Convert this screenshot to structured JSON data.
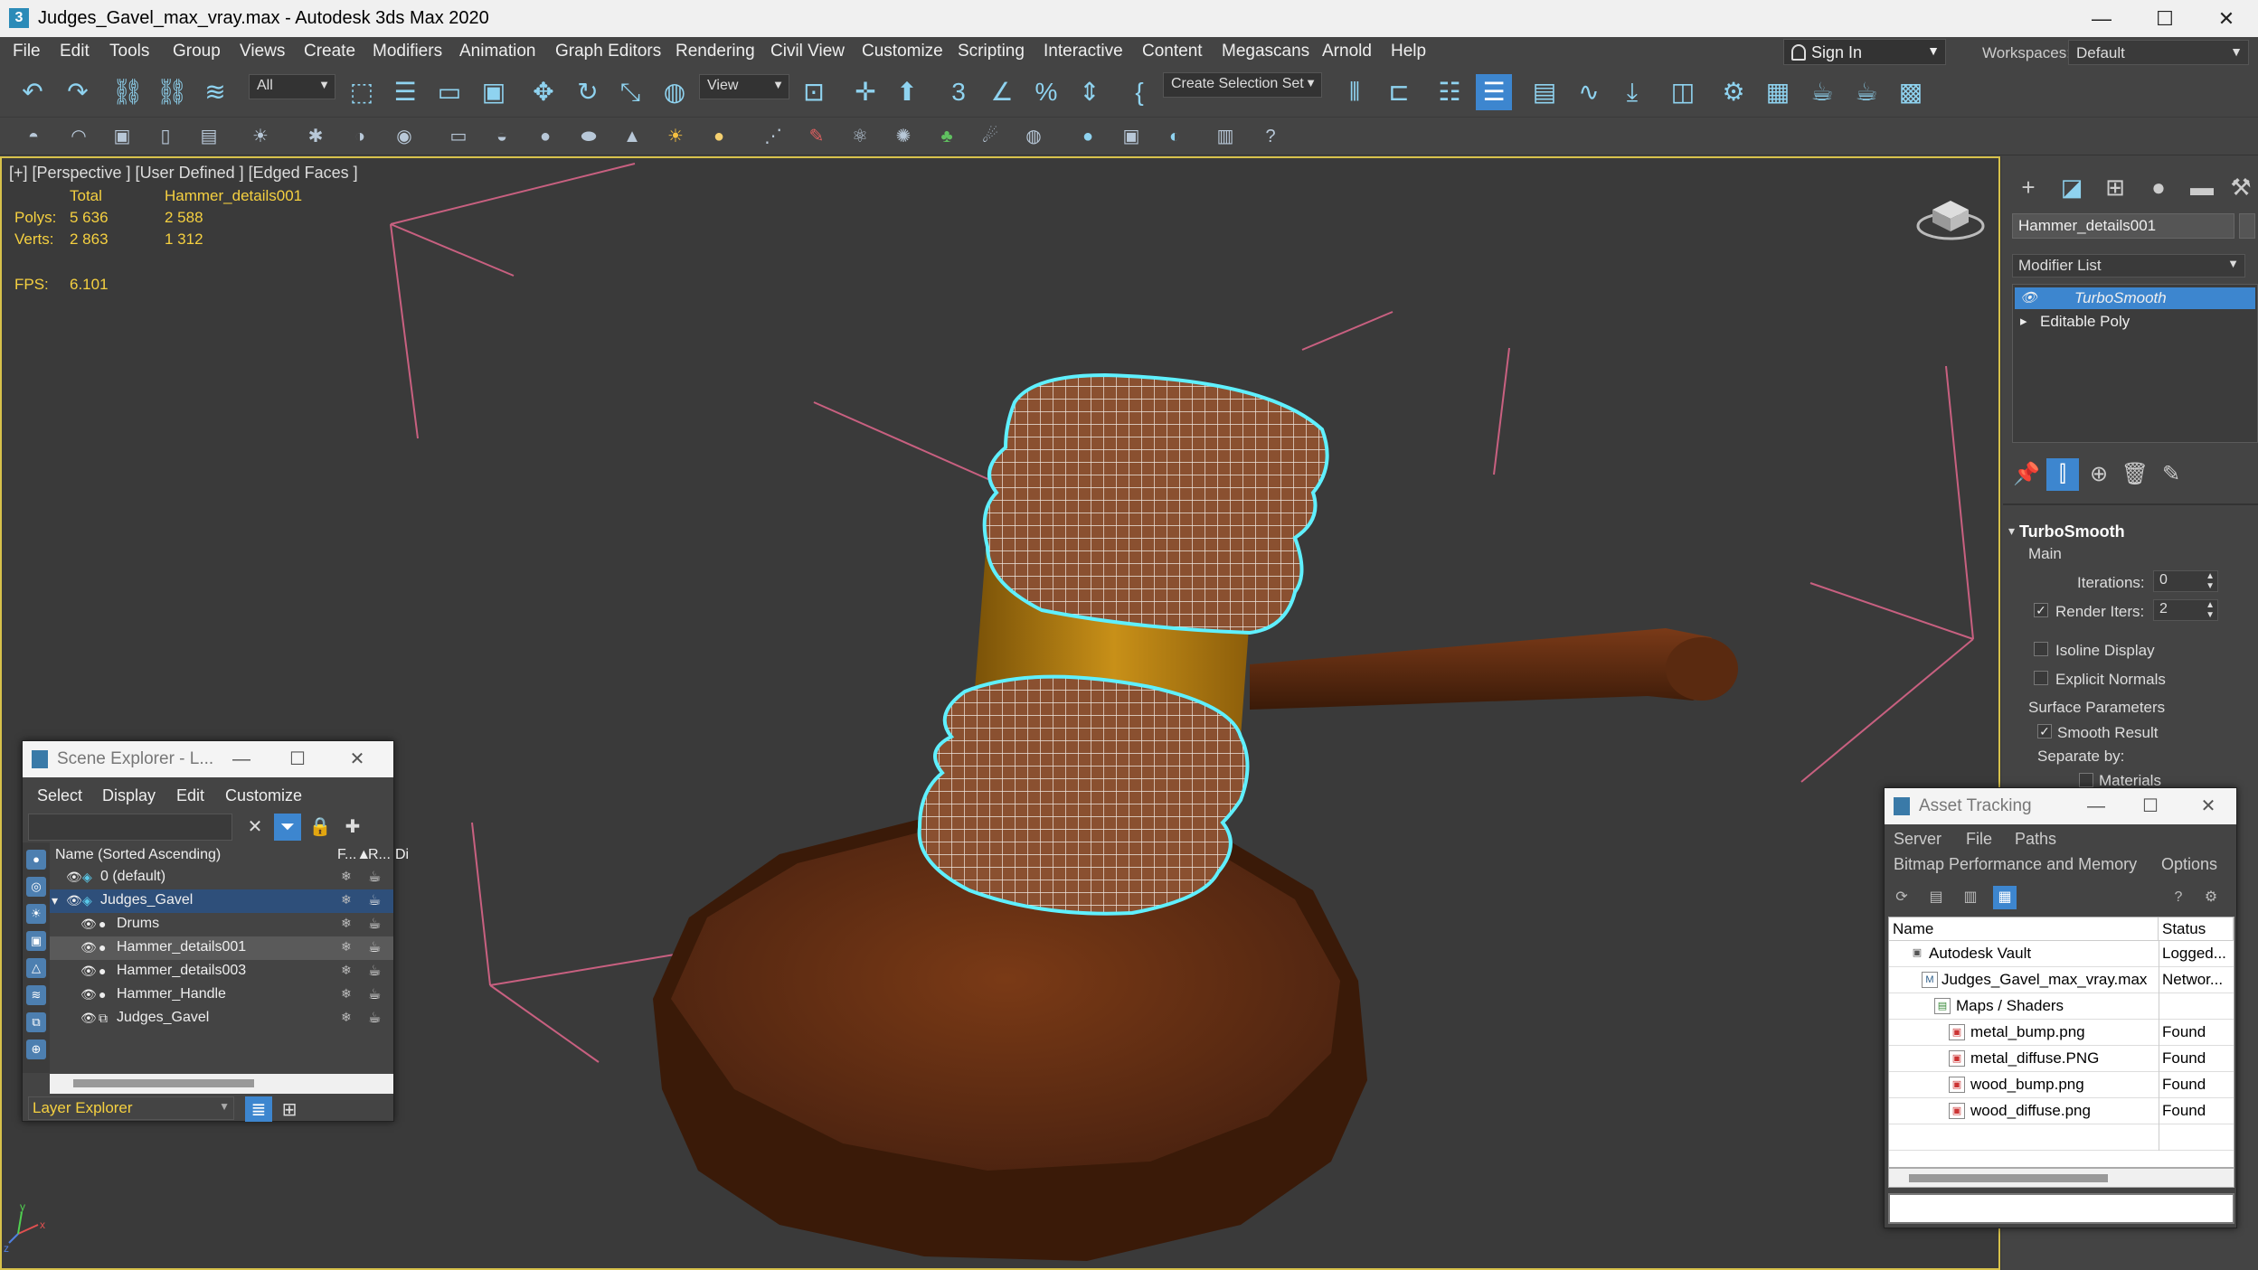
{
  "window": {
    "title": "Judges_Gavel_max_vray.max - Autodesk 3ds Max 2020",
    "app_icon": "3",
    "minimize": "—",
    "maximize": "☐",
    "close": "✕"
  },
  "menu": [
    "File",
    "Edit",
    "Tools",
    "Group",
    "Views",
    "Create",
    "Modifiers",
    "Animation",
    "Graph Editors",
    "Rendering",
    "Civil View",
    "Customize",
    "Scripting",
    "Interactive",
    "Content",
    "Megascans",
    "Arnold",
    "Help"
  ],
  "signin": {
    "label": "Sign In"
  },
  "workspaces": {
    "label": "Workspaces:",
    "value": "Default"
  },
  "toolbar": {
    "filter_value": "All",
    "refcoord_value": "View",
    "selection_set_placeholder": "Create Selection Set"
  },
  "viewport": {
    "label": "[+] [Perspective ] [User Defined ] [Edged Faces ]",
    "stats": {
      "total_label": "Total",
      "object_label": "Hammer_details001",
      "polys_label": "Polys:",
      "polys_total": "5 636",
      "polys_object": "2 588",
      "verts_label": "Verts:",
      "verts_total": "2 863",
      "verts_object": "1 312",
      "fps_label": "FPS:",
      "fps_value": "6.101"
    },
    "axis_labels": {
      "x": "x",
      "y": "y",
      "z": "z"
    }
  },
  "command_panel": {
    "object_name": "Hammer_details001",
    "modifier_list": "Modifier List",
    "stack": [
      {
        "label": "TurboSmooth",
        "selected": true
      },
      {
        "label": "Editable Poly",
        "selected": false
      }
    ],
    "rollout": {
      "title": "TurboSmooth",
      "main": "Main",
      "iterations_label": "Iterations:",
      "iterations_value": "0",
      "render_iters_label": "Render Iters:",
      "render_iters_value": "2",
      "isoline_label": "Isoline Display",
      "explicit_normals_label": "Explicit Normals",
      "surface_params": "Surface Parameters",
      "smooth_result": "Smooth Result",
      "separate_by": "Separate by:",
      "materials": "Materials"
    }
  },
  "scene_explorer": {
    "title": "Scene Explorer - L...",
    "menu": [
      "Select",
      "Display",
      "Edit",
      "Customize"
    ],
    "columns": {
      "name": "Name (Sorted Ascending)",
      "frozen": "F...▲",
      "render": "R...",
      "display": "Di"
    },
    "rows": [
      {
        "label": "0 (default)",
        "indent": 1
      },
      {
        "label": "Judges_Gavel",
        "indent": 1
      },
      {
        "label": "Drums",
        "indent": 2
      },
      {
        "label": "Hammer_details001",
        "indent": 2
      },
      {
        "label": "Hammer_details003",
        "indent": 2
      },
      {
        "label": "Hammer_Handle",
        "indent": 2
      },
      {
        "label": "Judges_Gavel",
        "indent": 2
      }
    ],
    "layer_explorer": "Layer Explorer"
  },
  "asset_tracking": {
    "title": "Asset Tracking",
    "menu1": [
      "Server",
      "File",
      "Paths"
    ],
    "menu2": [
      "Bitmap Performance and Memory",
      "Options"
    ],
    "columns": {
      "name": "Name",
      "status": "Status"
    },
    "rows": [
      {
        "name": "Autodesk Vault",
        "status": "Logged..."
      },
      {
        "name": "Judges_Gavel_max_vray.max",
        "status": "Networ..."
      },
      {
        "name": "Maps / Shaders",
        "status": ""
      },
      {
        "name": "metal_bump.png",
        "status": "Found"
      },
      {
        "name": "metal_diffuse.PNG",
        "status": "Found"
      },
      {
        "name": "wood_bump.png",
        "status": "Found"
      },
      {
        "name": "wood_diffuse.png",
        "status": "Found"
      }
    ]
  },
  "colors": {
    "accent_blue": "#3d86cf",
    "stats_yellow": "#f5d040",
    "selection_cyan": "#5ff0ff",
    "wood_dark": "#4a2510",
    "brass": "#b07a10"
  }
}
